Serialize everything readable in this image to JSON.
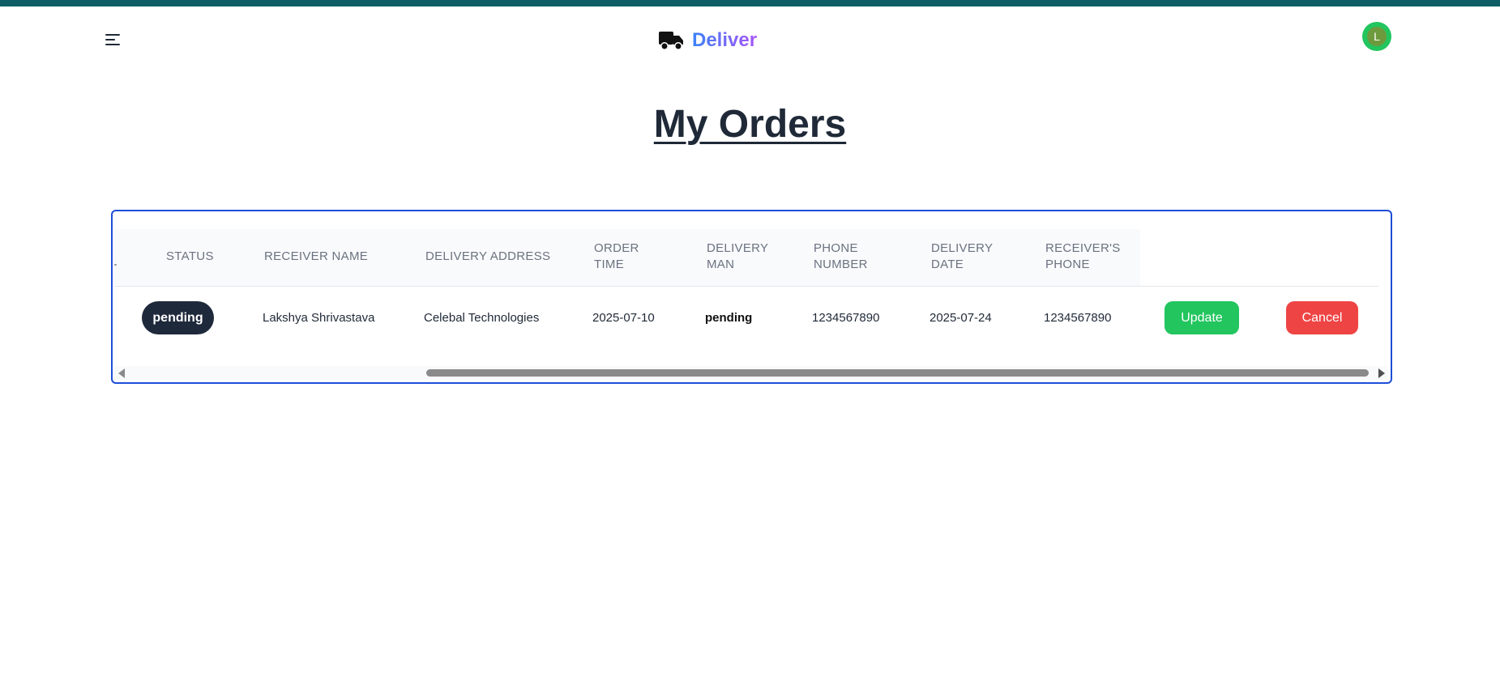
{
  "header": {
    "brand_name": "Deliver",
    "brand_icon": "truck-icon",
    "menu_icon": "hamburger-menu-icon",
    "avatar_initial": "L"
  },
  "page": {
    "title": "My Orders"
  },
  "table": {
    "columns": {
      "status": "STATUS",
      "receiver_name": "RECEIVER NAME",
      "delivery_address": "DELIVERY ADDRESS",
      "order_time_1": "ORDER",
      "order_time_2": "TIME",
      "delivery_man_1": "DELIVERY",
      "delivery_man_2": "MAN",
      "phone_number_1": "PHONE",
      "phone_number_2": "NUMBER",
      "delivery_date_1": "DELIVERY",
      "delivery_date_2": "DATE",
      "receivers_phone_1": "RECEIVER'S",
      "receivers_phone_2": "PHONE"
    },
    "rows": [
      {
        "status": "pending",
        "receiver_name": "Lakshya Shrivastava",
        "delivery_address": "Celebal Technologies",
        "order_time": "2025-07-10",
        "delivery_man": "pending",
        "phone_number": "1234567890",
        "delivery_date": "2025-07-24",
        "receivers_phone": "1234567890",
        "update_label": "Update",
        "cancel_label": "Cancel"
      }
    ]
  },
  "colors": {
    "topbar": "#0f5e66",
    "border_accent": "#1d4ed8",
    "update_button": "#22c55e",
    "cancel_button": "#ef4444",
    "status_pill": "#1e293b"
  }
}
